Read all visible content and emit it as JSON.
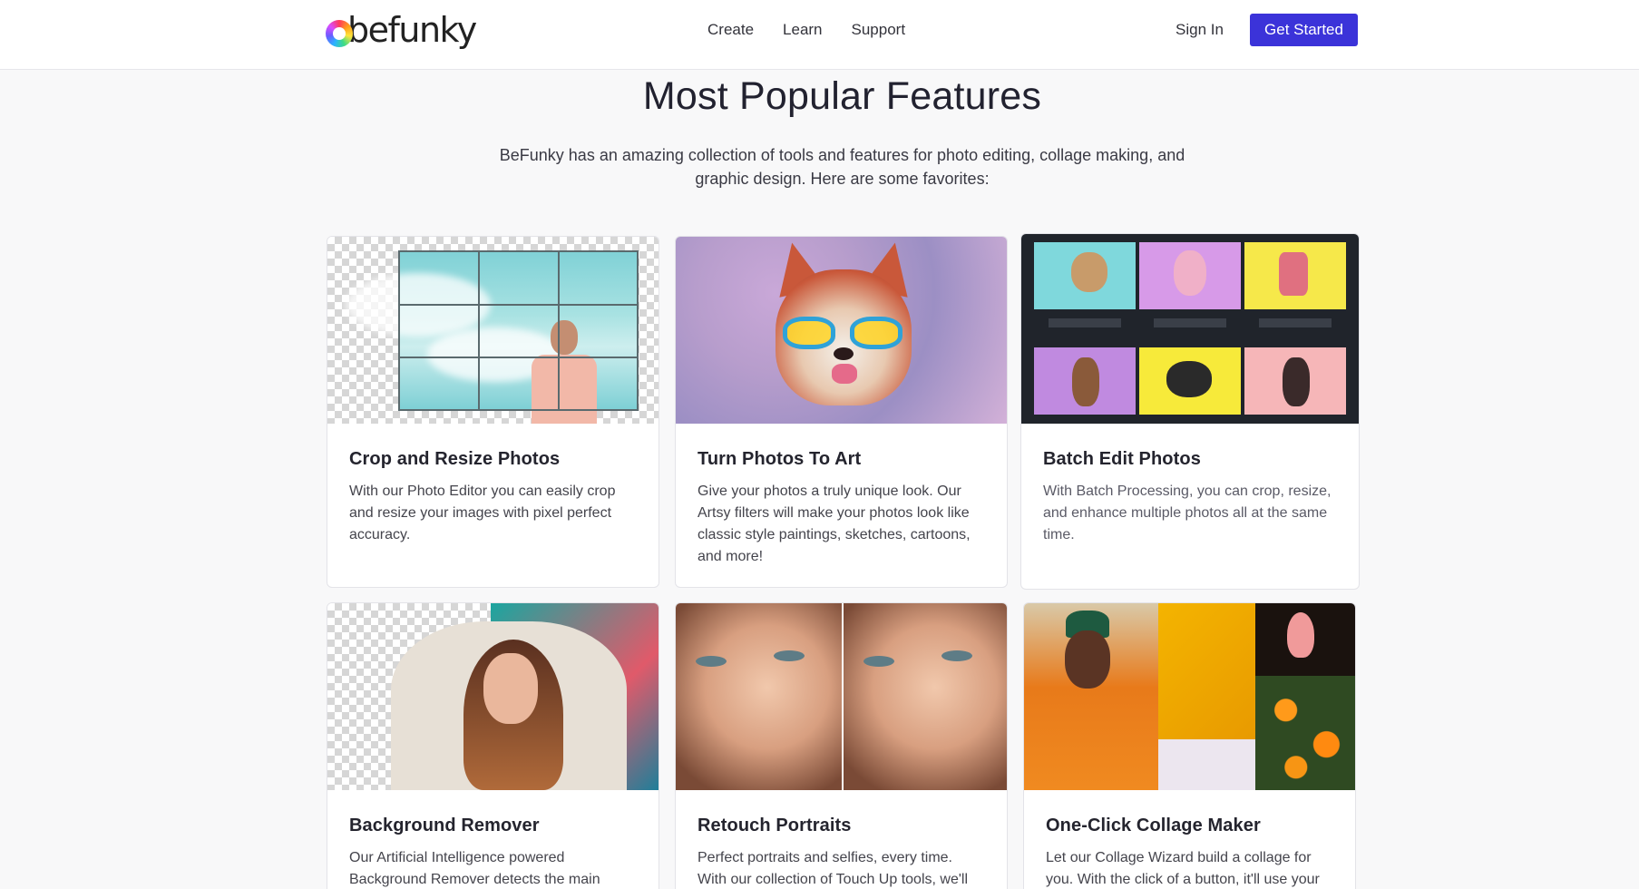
{
  "header": {
    "logo_text": "befunky",
    "nav": [
      {
        "label": "Create"
      },
      {
        "label": "Learn"
      },
      {
        "label": "Support"
      }
    ],
    "sign_in": "Sign In",
    "get_started": "Get Started"
  },
  "section": {
    "title": "Most Popular Features",
    "subtitle": "BeFunky has an amazing collection of tools and features for photo editing, collage making, and graphic design. Here are some favorites:"
  },
  "cards": [
    {
      "title": "Crop and Resize Photos",
      "text": "With our Photo Editor you can easily crop and resize your images with pixel perfect accuracy."
    },
    {
      "title": "Turn Photos To Art",
      "text": "Give your photos a truly unique look. Our Artsy filters will make your photos look like classic style paintings, sketches, cartoons, and more!"
    },
    {
      "title": "Batch Edit Photos",
      "text": "With Batch Processing, you can crop, resize, and enhance multiple photos all at the same time."
    },
    {
      "title": "Background Remover",
      "text": "Our Artificial Intelligence powered Background Remover detects the main"
    },
    {
      "title": "Retouch Portraits",
      "text": "Perfect portraits and selfies, every time. With our collection of Touch Up tools, we'll"
    },
    {
      "title": "One-Click Collage Maker",
      "text": "Let our Collage Wizard build a collage for you. With the click of a button, it'll use your"
    }
  ],
  "colors": {
    "accent": "#3b33d9",
    "page_bg": "#f8f8f9"
  }
}
